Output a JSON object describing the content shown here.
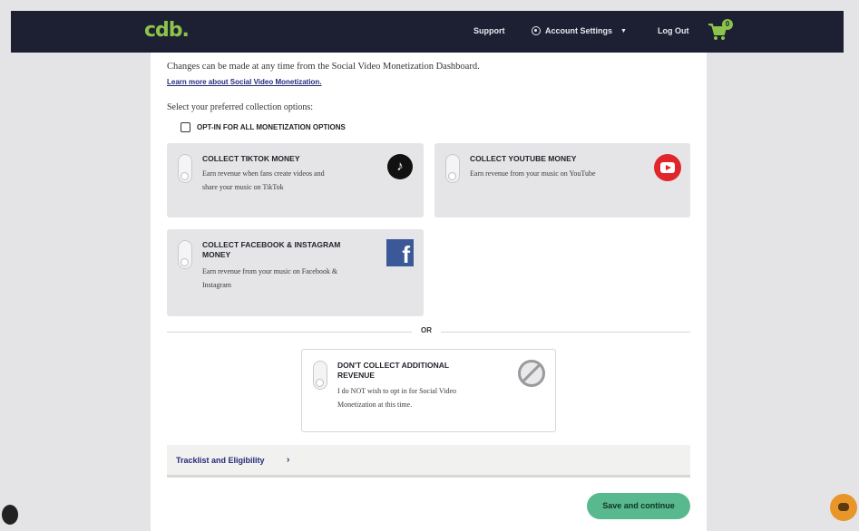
{
  "header": {
    "logo": "cdb.",
    "nav": {
      "support": "Support",
      "account_settings": "Account Settings",
      "log_out": "Log Out"
    },
    "cart_count": "0"
  },
  "intro": {
    "changes_text": "Changes can be made at any time from the Social Video Monetization Dashboard.",
    "learn_more": "Learn more about Social Video Monetization."
  },
  "collection": {
    "select_label": "Select your preferred collection options:",
    "optin_all": "OPT-IN FOR ALL MONETIZATION OPTIONS",
    "cards": [
      {
        "title": "COLLECT TIKTOK MONEY",
        "desc_line1": "Earn revenue when fans create videos and",
        "desc_line2": "share your music on TikTok",
        "icon": "tiktok-icon"
      },
      {
        "title": "COLLECT YOUTUBE MONEY",
        "desc_line1": "Earn revenue from your music on YouTube",
        "desc_line2": "",
        "icon": "youtube-icon"
      },
      {
        "title_line1": "COLLECT FACEBOOK & INSTAGRAM",
        "title_line2": "MONEY",
        "desc_line1": "Earn revenue from your music on Facebook &",
        "desc_line2": "Instagram",
        "icon": "facebook-icon"
      }
    ],
    "or_text": "OR",
    "decline": {
      "title_line1": "DON'T COLLECT ADDITIONAL",
      "title_line2": "REVENUE",
      "desc_line1": "I do NOT wish to opt in for Social Video",
      "desc_line2": "Monetization at this time.",
      "icon": "blocked-icon"
    }
  },
  "tracklist": {
    "label": "Tracklist and Eligibility",
    "chevron": "›"
  },
  "actions": {
    "save": "Save and continue"
  },
  "colors": {
    "topbar": "#1d1f33",
    "brand_green": "#8cc34a",
    "save_button": "#57b98d",
    "link": "#262a7a",
    "card_bg": "#e5e5e8"
  }
}
